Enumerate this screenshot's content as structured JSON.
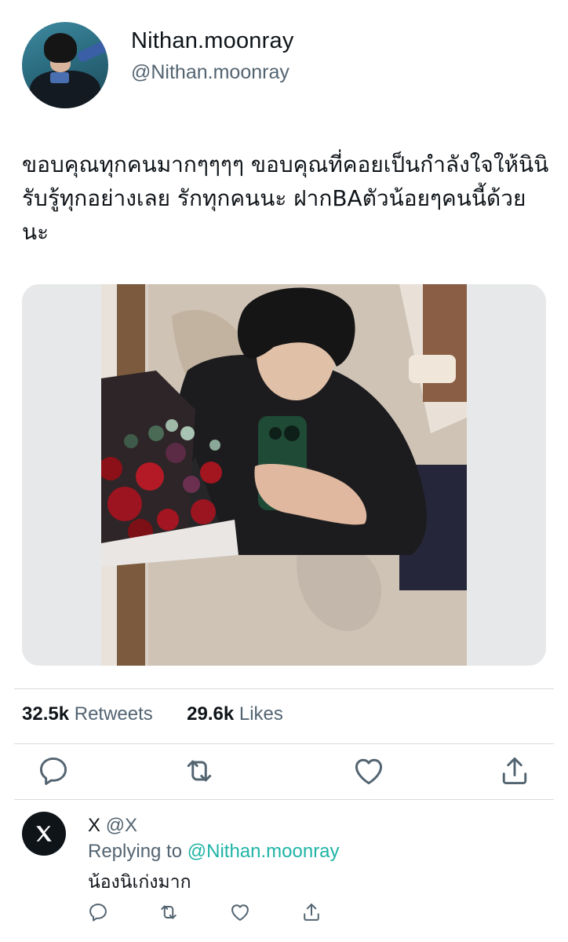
{
  "profile": {
    "name": "Nithan.moonray",
    "handle": "@Nithan.moonray"
  },
  "tweet": {
    "text": "ขอบคุณทุกคนมากๆๆๆๆ ขอบคุณที่คอยเป็นกำลังใจให้นินิรับรู้ทุกอย่างเลย รักทุกคนนะ ฝากBAตัวน้อยๆคนนี้ด้วยนะ"
  },
  "stats": {
    "retweets_count": "32.5k",
    "retweets_label": "Retweets",
    "likes_count": "29.6k",
    "likes_label": "Likes"
  },
  "actions": {
    "icons": [
      "reply-icon",
      "retweet-icon",
      "like-icon",
      "share-icon"
    ]
  },
  "reply": {
    "author_name": "X",
    "author_handle": "@X",
    "replying_prefix": "Replying to",
    "replying_to": "@Nithan.moonray",
    "text": "น้องนิเก่งมาก"
  },
  "colors": {
    "text": "#0f1419",
    "secondary": "#536471",
    "mention": "#1fb4a6",
    "icon": "#536471",
    "divider": "#d6d9dc"
  }
}
